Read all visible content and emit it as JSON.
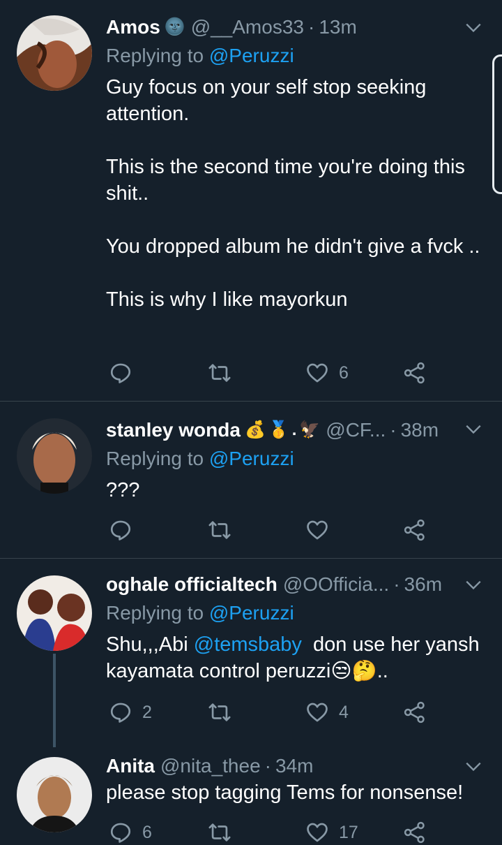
{
  "tweets": [
    {
      "name": "Amos",
      "emoji": [
        "🌚"
      ],
      "handle": "@__Amos33",
      "time": "13m",
      "reply_prefix": "Replying to ",
      "reply_to": "@Peruzzi",
      "paragraphs": [
        "Guy focus on your self stop seeking attention.",
        "This is the second time you're doing this shit..",
        "You dropped album he didn't give a fvck ..",
        "This is why I like mayorkun"
      ],
      "replies": "",
      "retweets": "",
      "likes": "6"
    },
    {
      "name": "stanley wonda",
      "emoji": [
        "💰",
        "🥇",
        ".",
        "🦅"
      ],
      "handle": "@CF...",
      "time": "38m",
      "reply_prefix": "Replying to ",
      "reply_to": "@Peruzzi",
      "text": "???",
      "replies": "",
      "retweets": "",
      "likes": ""
    },
    {
      "name": "oghale officialtech",
      "handle": "@OOfficia...",
      "time": "36m",
      "reply_prefix": "Replying to ",
      "reply_to": "@Peruzzi",
      "text_prefix": "Shu,,,Abi ",
      "text_mention": "@temsbaby",
      "text_suffix": "  don use her yansh kayamata control peruzzi😒🤔..",
      "replies": "2",
      "retweets": "",
      "likes": "4"
    },
    {
      "name": "Anita",
      "handle": "@nita_thee",
      "time": "34m",
      "text": "please stop tagging Tems for nonsense!",
      "replies": "6",
      "retweets": "",
      "likes": "17"
    }
  ],
  "icons": {
    "reply": "reply-icon",
    "retweet": "retweet-icon",
    "like": "heart-icon",
    "share": "share-icon",
    "more": "chevron-down-icon"
  },
  "colors": {
    "background": "#15202b",
    "secondary_text": "#8899a6",
    "link": "#1da1f2",
    "divider": "#38444d"
  }
}
